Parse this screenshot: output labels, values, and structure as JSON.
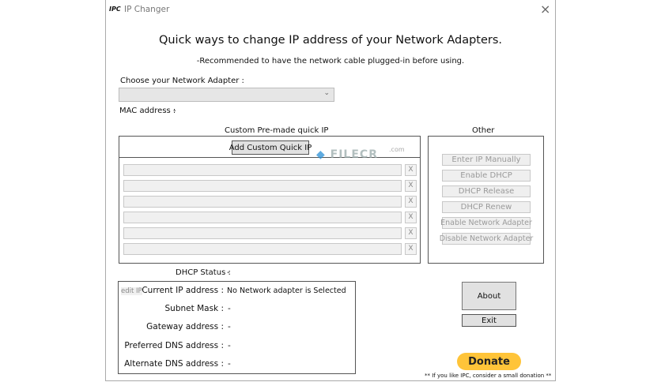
{
  "window": {
    "logo": "IPC",
    "title": "IP Changer",
    "close": "×"
  },
  "header": {
    "title": "Quick ways to change IP address of your Network Adapters.",
    "subtitle": "-Recommended to have the network cable plugged-in before using."
  },
  "adapter": {
    "label": "Choose your Network Adapter :",
    "value": "",
    "mac_label": "MAC address :",
    "mac_value": "-"
  },
  "quick_ip": {
    "title": "Custom Pre-made quick IP",
    "add_button": "Add Custom Quick IP",
    "rows": [
      "",
      "",
      "",
      "",
      "",
      ""
    ],
    "remove_label": "X"
  },
  "other": {
    "title": "Other",
    "buttons": [
      "Enter IP Manually",
      "Enable DHCP",
      "DHCP Release",
      "DHCP Renew",
      "Enable Network Adapter",
      "Disable Network Adapter"
    ]
  },
  "status": {
    "dhcp_label": "DHCP Status :",
    "dhcp_value": "-",
    "edit_ip": "edit IP",
    "fields": [
      {
        "label": "Current IP address :",
        "value": "No Network adapter is Selected"
      },
      {
        "label": "Subnet Mask :",
        "value": "-"
      },
      {
        "label": "Gateway address :",
        "value": "-"
      },
      {
        "label": "Preferred DNS address :",
        "value": "-"
      },
      {
        "label": "Alternate DNS address :",
        "value": "-"
      }
    ]
  },
  "actions": {
    "about": "About",
    "exit": "Exit",
    "donate": "Donate",
    "donate_note": "** If you like IPC, consider a small donation **"
  },
  "watermark": {
    "brand": "FILECR",
    "suffix": ".com"
  },
  "colors": {
    "donate": "#ffc439",
    "accent": "#2a8fd6"
  }
}
